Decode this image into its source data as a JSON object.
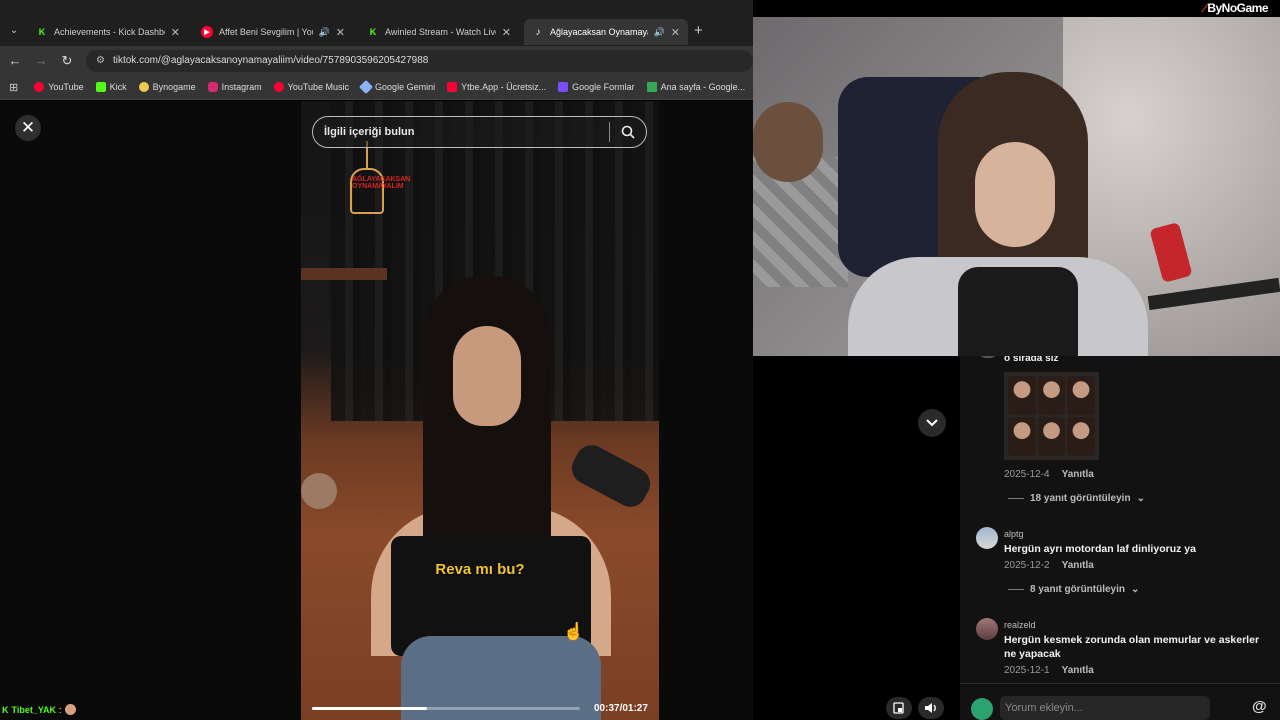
{
  "browser": {
    "tabs": [
      {
        "label": "Achievements - Kick Dashboard",
        "icon": "kick-icon",
        "color": "#53fc18",
        "active": false
      },
      {
        "label": "Affet Beni Sevgilim | YouTub",
        "icon": "youtube-music-icon",
        "color": "#ff0033",
        "active": false
      },
      {
        "label": "Awinled Stream - Watch Live on",
        "icon": "kick-icon",
        "color": "#53fc18",
        "active": false
      },
      {
        "label": "Ağlayacaksan Oynamayalım",
        "icon": "tiktok-icon",
        "color": "#ffffff",
        "active": true
      }
    ],
    "url": "tiktok.com/@aglayacaksanoynamayaliim/video/7578903596205427988",
    "bookmarks": [
      {
        "label": "YouTube",
        "color": "#ff0033"
      },
      {
        "label": "Kick",
        "color": "#53fc18"
      },
      {
        "label": "Bynogame",
        "color": "#f2c94c"
      },
      {
        "label": "Instagram",
        "color": "#d62976"
      },
      {
        "label": "YouTube Music",
        "color": "#ff0033"
      },
      {
        "label": "Google Gemini",
        "color": "#8ab4f8"
      },
      {
        "label": "Ytbe.App - Ücretsiz...",
        "color": "#ff0033"
      },
      {
        "label": "Google Formlar",
        "color": "#7c4dff"
      },
      {
        "label": "Ana sayfa - Google...",
        "color": "#34a853"
      }
    ]
  },
  "tiktok": {
    "search_placeholder": "İlgili içeriği bulun",
    "video_logo_text": "AĞLAYACAKSAN OYNAMAYALIM",
    "subtitle": "Reva mı bu?",
    "time": "00:37/01:27",
    "progress": 0.43
  },
  "brand": {
    "name": "ByNoGame"
  },
  "comments": {
    "partial": {
      "text": "o sırada siz"
    },
    "first_meta": {
      "date": "2025-12-4",
      "reply": "Yanıtla",
      "more": "18 yanıt görüntüleyin"
    },
    "items": [
      {
        "user": "alptg",
        "text": "Hergün ayrı motordan laf dinliyoruz ya",
        "date": "2025-12-2",
        "reply": "Yanıtla",
        "more": "8 yanıt görüntüleyin"
      },
      {
        "user": "realzeld",
        "text": "Hergün kesmek zorunda olan memurlar ve askerler ne yapacak",
        "date": "2025-12-1",
        "reply": "Yanıtla"
      }
    ],
    "input_placeholder": "Yorum ekleyin...",
    "at_symbol": "@"
  },
  "chat": {
    "user": "Tibet_YAK",
    "sep": ":"
  }
}
